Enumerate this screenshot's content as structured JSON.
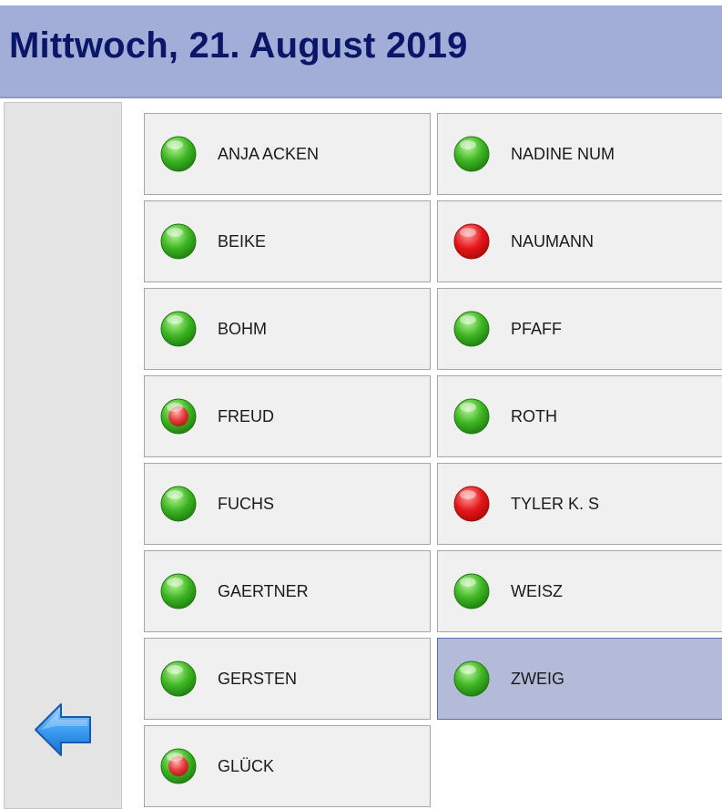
{
  "header": {
    "title": "Mittwoch, 21. August 2019"
  },
  "sidebar": {
    "back_icon": "arrow-left-icon"
  },
  "colors": {
    "header_bg": "#a3aed8",
    "header_text": "#0a1668",
    "status_present": "#3cb521",
    "status_absent": "#e4161a",
    "status_partial": "#e63c3c",
    "selected_bg": "#b3bbd9"
  },
  "people": [
    {
      "name": "ANJA ACKEN",
      "status": "present"
    },
    {
      "name": "NADINE NUM",
      "status": "present"
    },
    {
      "name": "BEIKE",
      "status": "present"
    },
    {
      "name": "NAUMANN",
      "status": "absent"
    },
    {
      "name": "BOHM",
      "status": "present"
    },
    {
      "name": "PFAFF",
      "status": "present"
    },
    {
      "name": "FREUD",
      "status": "partial"
    },
    {
      "name": "ROTH",
      "status": "present"
    },
    {
      "name": "FUCHS",
      "status": "present"
    },
    {
      "name": "TYLER K. S",
      "status": "absent"
    },
    {
      "name": "GAERTNER",
      "status": "present"
    },
    {
      "name": "WEISZ",
      "status": "present"
    },
    {
      "name": "GERSTEN",
      "status": "present"
    },
    {
      "name": "ZWEIG",
      "status": "present",
      "selected": true
    },
    {
      "name": "GLÜCK",
      "status": "partial"
    }
  ]
}
